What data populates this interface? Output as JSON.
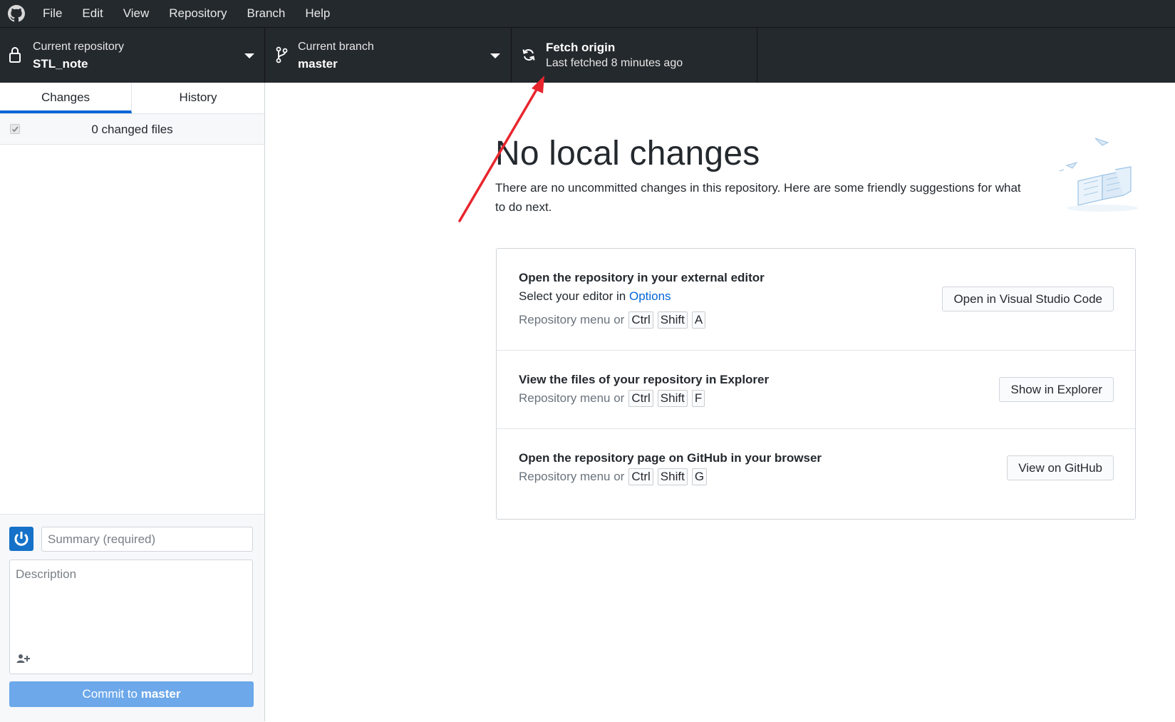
{
  "menubar": {
    "icon": "github-logo-icon",
    "items": [
      "File",
      "Edit",
      "View",
      "Repository",
      "Branch",
      "Help"
    ]
  },
  "toolbar": {
    "repository": {
      "label": "Current repository",
      "value": "STL_note",
      "icon": "lock-icon"
    },
    "branch": {
      "label": "Current branch",
      "value": "master",
      "icon": "branch-icon"
    },
    "fetch": {
      "label": "Fetch origin",
      "status": "Last fetched 8 minutes ago",
      "icon": "sync-icon"
    }
  },
  "sidebar": {
    "tabs": [
      "Changes",
      "History"
    ],
    "selected_tab": "Changes",
    "changed_files": "0 changed files",
    "commit": {
      "summary_placeholder": "Summary (required)",
      "description_placeholder": "Description",
      "button_prefix": "Commit to ",
      "button_branch": "master"
    }
  },
  "main": {
    "title": "No local changes",
    "description": "There are no uncommitted changes in this repository. Here are some friendly suggestions for what to do next.",
    "shortcut_prefix": "Repository menu or",
    "suggestions": [
      {
        "title": "Open the repository in your external editor",
        "subtitle_prefix": "Select your editor in ",
        "subtitle_link": "Options",
        "keys": [
          "Ctrl",
          "Shift",
          "A"
        ],
        "button": "Open in Visual Studio Code"
      },
      {
        "title": "View the files of your repository in Explorer",
        "keys": [
          "Ctrl",
          "Shift",
          "F"
        ],
        "button": "Show in Explorer"
      },
      {
        "title": "Open the repository page on GitHub in your browser",
        "keys": [
          "Ctrl",
          "Shift",
          "G"
        ],
        "button": "View on GitHub"
      }
    ]
  },
  "colors": {
    "toolbar_bg": "#24292e",
    "accent": "#0366d6",
    "commit_button": "#6ca8ea",
    "annotation_arrow": "#e8262d"
  }
}
